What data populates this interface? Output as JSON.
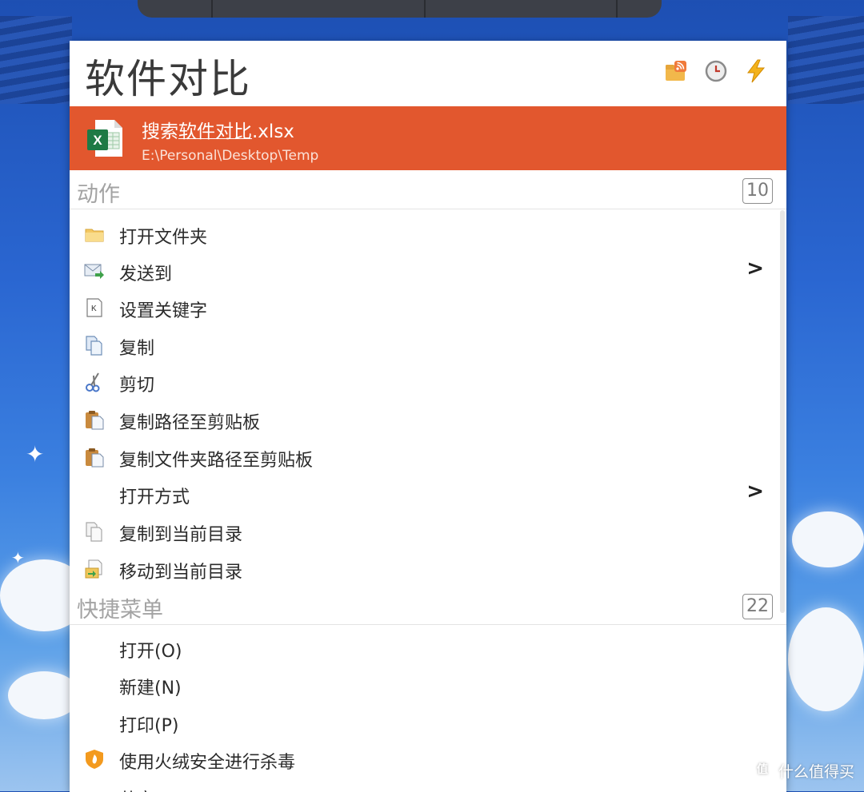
{
  "query": "软件对比",
  "header_icons": [
    "rss-folder-icon",
    "clock-icon",
    "lightning-icon"
  ],
  "result": {
    "title_prefix": "搜索",
    "title_match": "软件对比",
    "title_suffix": ".xlsx",
    "path": "E:\\Personal\\Desktop\\Temp",
    "icon": "excel-file-icon",
    "highlight_color": "#e2572e"
  },
  "sections": {
    "actions": {
      "label": "动作",
      "count": "10",
      "items": [
        {
          "label": "打开文件夹",
          "icon": "folder-icon"
        },
        {
          "label": "发送到",
          "icon": "send-mail-icon",
          "submenu": ">"
        },
        {
          "label": "设置关键字",
          "icon": "keyword-icon"
        },
        {
          "label": "复制",
          "icon": "copy-icon"
        },
        {
          "label": "剪切",
          "icon": "scissors-icon"
        },
        {
          "label": "复制路径至剪贴板",
          "icon": "clipboard-icon"
        },
        {
          "label": "复制文件夹路径至剪贴板",
          "icon": "clipboard-icon"
        },
        {
          "label": "打开方式",
          "icon": "",
          "submenu": ">"
        },
        {
          "label": "复制到当前目录",
          "icon": "copy-icon"
        },
        {
          "label": "移动到当前目录",
          "icon": "move-file-icon"
        }
      ]
    },
    "quick_menu": {
      "label": "快捷菜单",
      "count": "22",
      "items": [
        {
          "label": "打开(O)",
          "icon": ""
        },
        {
          "label": "新建(N)",
          "icon": ""
        },
        {
          "label": "打印(P)",
          "icon": ""
        },
        {
          "label": "使用火绒安全进行杀毒",
          "icon": "huorong-shield-icon"
        },
        {
          "label": "共享",
          "icon": ""
        }
      ]
    }
  },
  "watermark": {
    "logo": "值",
    "text": "什么值得买"
  }
}
